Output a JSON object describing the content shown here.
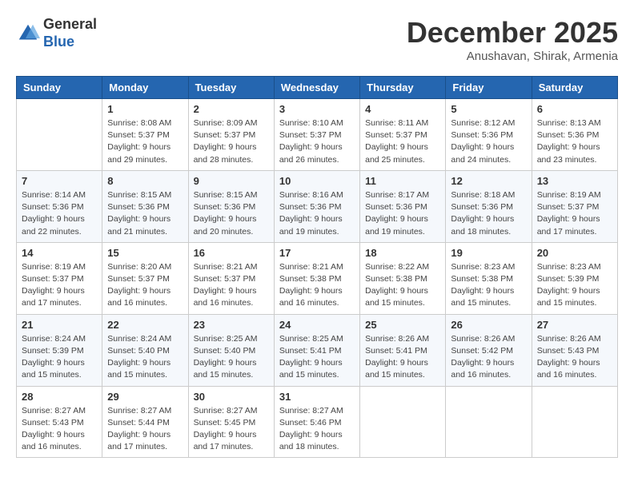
{
  "logo": {
    "general": "General",
    "blue": "Blue"
  },
  "title": "December 2025",
  "subtitle": "Anushavan, Shirak, Armenia",
  "header_days": [
    "Sunday",
    "Monday",
    "Tuesday",
    "Wednesday",
    "Thursday",
    "Friday",
    "Saturday"
  ],
  "weeks": [
    [
      {
        "day": "",
        "info": ""
      },
      {
        "day": "1",
        "info": "Sunrise: 8:08 AM\nSunset: 5:37 PM\nDaylight: 9 hours\nand 29 minutes."
      },
      {
        "day": "2",
        "info": "Sunrise: 8:09 AM\nSunset: 5:37 PM\nDaylight: 9 hours\nand 28 minutes."
      },
      {
        "day": "3",
        "info": "Sunrise: 8:10 AM\nSunset: 5:37 PM\nDaylight: 9 hours\nand 26 minutes."
      },
      {
        "day": "4",
        "info": "Sunrise: 8:11 AM\nSunset: 5:37 PM\nDaylight: 9 hours\nand 25 minutes."
      },
      {
        "day": "5",
        "info": "Sunrise: 8:12 AM\nSunset: 5:36 PM\nDaylight: 9 hours\nand 24 minutes."
      },
      {
        "day": "6",
        "info": "Sunrise: 8:13 AM\nSunset: 5:36 PM\nDaylight: 9 hours\nand 23 minutes."
      }
    ],
    [
      {
        "day": "7",
        "info": "Sunrise: 8:14 AM\nSunset: 5:36 PM\nDaylight: 9 hours\nand 22 minutes."
      },
      {
        "day": "8",
        "info": "Sunrise: 8:15 AM\nSunset: 5:36 PM\nDaylight: 9 hours\nand 21 minutes."
      },
      {
        "day": "9",
        "info": "Sunrise: 8:15 AM\nSunset: 5:36 PM\nDaylight: 9 hours\nand 20 minutes."
      },
      {
        "day": "10",
        "info": "Sunrise: 8:16 AM\nSunset: 5:36 PM\nDaylight: 9 hours\nand 19 minutes."
      },
      {
        "day": "11",
        "info": "Sunrise: 8:17 AM\nSunset: 5:36 PM\nDaylight: 9 hours\nand 19 minutes."
      },
      {
        "day": "12",
        "info": "Sunrise: 8:18 AM\nSunset: 5:36 PM\nDaylight: 9 hours\nand 18 minutes."
      },
      {
        "day": "13",
        "info": "Sunrise: 8:19 AM\nSunset: 5:37 PM\nDaylight: 9 hours\nand 17 minutes."
      }
    ],
    [
      {
        "day": "14",
        "info": "Sunrise: 8:19 AM\nSunset: 5:37 PM\nDaylight: 9 hours\nand 17 minutes."
      },
      {
        "day": "15",
        "info": "Sunrise: 8:20 AM\nSunset: 5:37 PM\nDaylight: 9 hours\nand 16 minutes."
      },
      {
        "day": "16",
        "info": "Sunrise: 8:21 AM\nSunset: 5:37 PM\nDaylight: 9 hours\nand 16 minutes."
      },
      {
        "day": "17",
        "info": "Sunrise: 8:21 AM\nSunset: 5:38 PM\nDaylight: 9 hours\nand 16 minutes."
      },
      {
        "day": "18",
        "info": "Sunrise: 8:22 AM\nSunset: 5:38 PM\nDaylight: 9 hours\nand 15 minutes."
      },
      {
        "day": "19",
        "info": "Sunrise: 8:23 AM\nSunset: 5:38 PM\nDaylight: 9 hours\nand 15 minutes."
      },
      {
        "day": "20",
        "info": "Sunrise: 8:23 AM\nSunset: 5:39 PM\nDaylight: 9 hours\nand 15 minutes."
      }
    ],
    [
      {
        "day": "21",
        "info": "Sunrise: 8:24 AM\nSunset: 5:39 PM\nDaylight: 9 hours\nand 15 minutes."
      },
      {
        "day": "22",
        "info": "Sunrise: 8:24 AM\nSunset: 5:40 PM\nDaylight: 9 hours\nand 15 minutes."
      },
      {
        "day": "23",
        "info": "Sunrise: 8:25 AM\nSunset: 5:40 PM\nDaylight: 9 hours\nand 15 minutes."
      },
      {
        "day": "24",
        "info": "Sunrise: 8:25 AM\nSunset: 5:41 PM\nDaylight: 9 hours\nand 15 minutes."
      },
      {
        "day": "25",
        "info": "Sunrise: 8:26 AM\nSunset: 5:41 PM\nDaylight: 9 hours\nand 15 minutes."
      },
      {
        "day": "26",
        "info": "Sunrise: 8:26 AM\nSunset: 5:42 PM\nDaylight: 9 hours\nand 16 minutes."
      },
      {
        "day": "27",
        "info": "Sunrise: 8:26 AM\nSunset: 5:43 PM\nDaylight: 9 hours\nand 16 minutes."
      }
    ],
    [
      {
        "day": "28",
        "info": "Sunrise: 8:27 AM\nSunset: 5:43 PM\nDaylight: 9 hours\nand 16 minutes."
      },
      {
        "day": "29",
        "info": "Sunrise: 8:27 AM\nSunset: 5:44 PM\nDaylight: 9 hours\nand 17 minutes."
      },
      {
        "day": "30",
        "info": "Sunrise: 8:27 AM\nSunset: 5:45 PM\nDaylight: 9 hours\nand 17 minutes."
      },
      {
        "day": "31",
        "info": "Sunrise: 8:27 AM\nSunset: 5:46 PM\nDaylight: 9 hours\nand 18 minutes."
      },
      {
        "day": "",
        "info": ""
      },
      {
        "day": "",
        "info": ""
      },
      {
        "day": "",
        "info": ""
      }
    ]
  ]
}
